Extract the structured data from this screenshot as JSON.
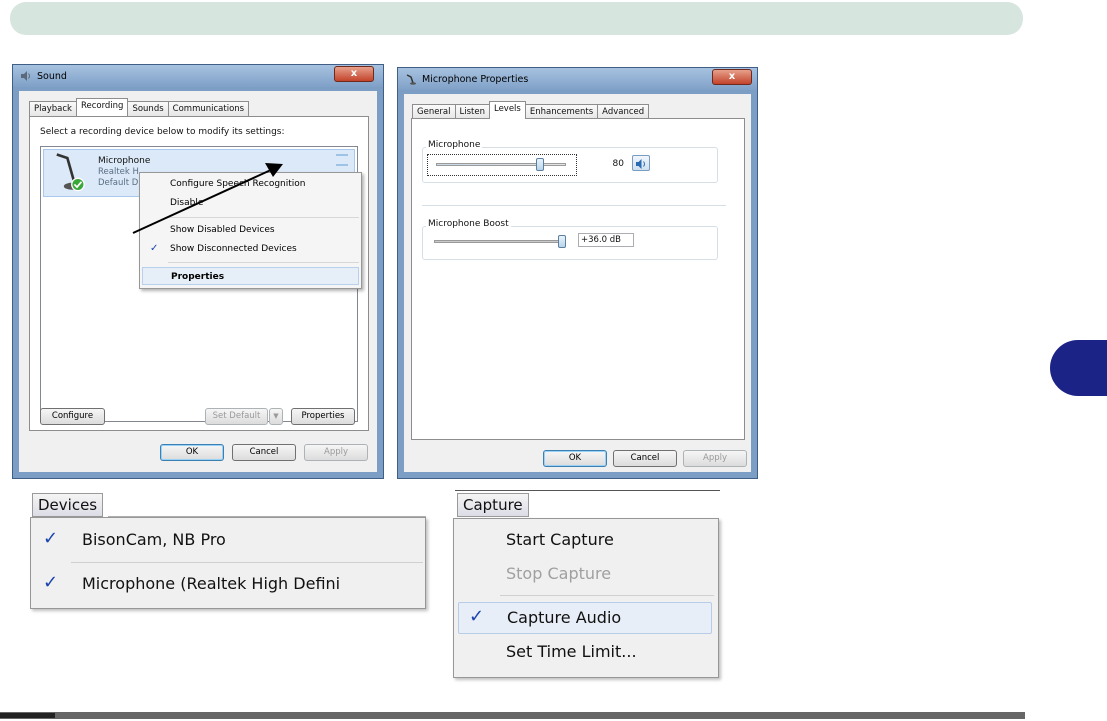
{
  "sound_dialog": {
    "title": "Sound",
    "close": "x",
    "tabs": [
      "Playback",
      "Recording",
      "Sounds",
      "Communications"
    ],
    "instruction": "Select a recording device below to modify its settings:",
    "device": {
      "name": "Microphone",
      "line2": "Realtek H",
      "line3": "Default D"
    },
    "context_menu": {
      "items": [
        "Configure Speech Recognition",
        "Disable",
        "Show Disabled Devices",
        "Show Disconnected Devices",
        "Properties"
      ],
      "checked": "Show Disconnected Devices",
      "highlighted": "Properties"
    },
    "buttons": {
      "configure": "Configure",
      "set_default": "Set Default",
      "properties": "Properties",
      "ok": "OK",
      "cancel": "Cancel",
      "apply": "Apply"
    }
  },
  "mic_properties": {
    "title": "Microphone Properties",
    "close": "x",
    "tabs": [
      "General",
      "Listen",
      "Levels",
      "Enhancements",
      "Advanced"
    ],
    "microphone_label": "Microphone",
    "microphone_value": "80",
    "boost_label": "Microphone Boost",
    "boost_value": "+36.0 dB",
    "microphone_level_fraction": 0.8,
    "boost_level_fraction": 1.0,
    "buttons": {
      "ok": "OK",
      "cancel": "Cancel",
      "apply": "Apply"
    }
  },
  "devices_menu": {
    "label": "Devices",
    "items": [
      "BisonCam, NB Pro",
      "Microphone (Realtek High Defini"
    ]
  },
  "capture_menu": {
    "label": "Capture",
    "items": [
      "Start Capture",
      "Stop Capture",
      "Capture Audio",
      "Set Time Limit..."
    ],
    "disabled": "Stop Capture",
    "checked": "Capture Audio"
  },
  "colors": {
    "top_bar": "#d6e6df",
    "side_tab": "#1b2386",
    "check": "#1a43b0"
  }
}
